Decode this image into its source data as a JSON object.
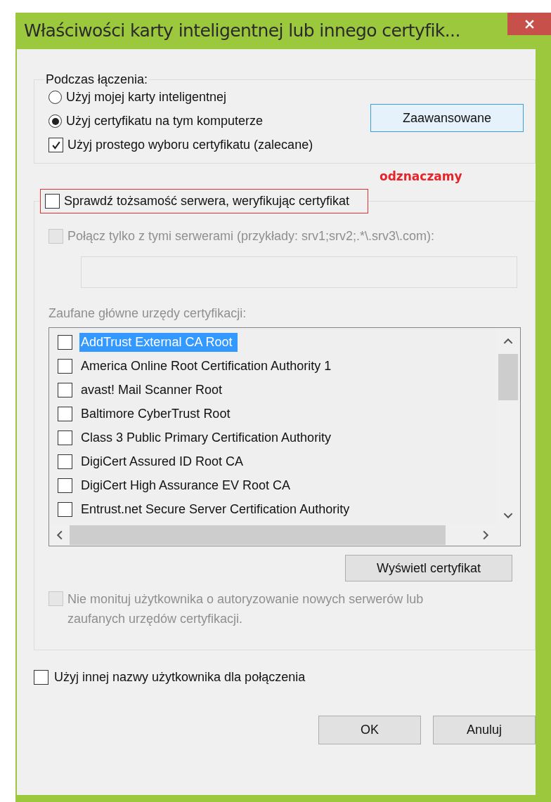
{
  "window": {
    "title": "Właściwości karty inteligentnej lub innego certyfik..."
  },
  "connection": {
    "legend": "Podczas łączenia:",
    "radios": [
      {
        "label": "Użyj mojej karty inteligentnej",
        "selected": false
      },
      {
        "label": "Użyj certyfikatu na tym komputerze",
        "selected": true
      }
    ],
    "simple_selection": {
      "label": "Użyj prostego wyboru certyfikatu (zalecane)",
      "checked": true
    },
    "advanced_button": "Zaawansowane"
  },
  "annotation": {
    "text": "odznaczamy"
  },
  "verify_server": {
    "label": "Sprawdź tożsamość serwera, weryfikując certyfikat",
    "checked": false,
    "highlighted": true
  },
  "servers_only": {
    "label": "Połącz tylko z tymi serwerami (przykłady: srv1;srv2;.*\\.srv3\\.com):",
    "checked": false,
    "disabled": true
  },
  "servers_field": {
    "disabled": true
  },
  "trusted_label": {
    "text": "Zaufane główne urzędy certyfikacji:",
    "disabled": true
  },
  "cert_list": {
    "items": [
      {
        "label": "AddTrust External CA Root",
        "checked": false,
        "selected": true
      },
      {
        "label": "America Online Root Certification Authority 1",
        "checked": false,
        "selected": false
      },
      {
        "label": "avast! Mail Scanner Root",
        "checked": false,
        "selected": false
      },
      {
        "label": "Baltimore CyberTrust Root",
        "checked": false,
        "selected": false
      },
      {
        "label": "Class 3 Public Primary Certification Authority",
        "checked": false,
        "selected": false
      },
      {
        "label": "DigiCert Assured ID Root CA",
        "checked": false,
        "selected": false
      },
      {
        "label": "DigiCert High Assurance EV Root CA",
        "checked": false,
        "selected": false
      },
      {
        "label": "Entrust.net Secure Server Certification Authority",
        "checked": false,
        "selected": false
      }
    ]
  },
  "view_button": "Wyświetl certyfikat",
  "no_prompt": {
    "label": "Nie monituj użytkownika o autoryzowanie nowych serwerów lub zaufanych urzędów certyfikacji.",
    "checked": false,
    "disabled": true
  },
  "other_user": {
    "label": "Użyj innej nazwy użytkownika dla połączenia",
    "checked": false
  },
  "buttons": [
    "OK",
    "Anuluj"
  ]
}
